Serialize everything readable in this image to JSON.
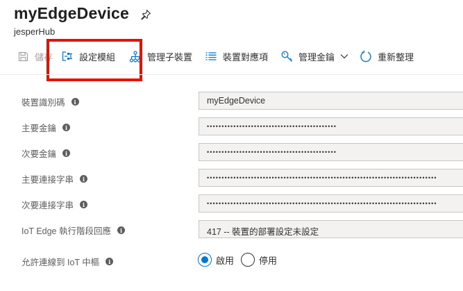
{
  "header": {
    "title": "myEdgeDevice",
    "subtitle": "jesperHub"
  },
  "toolbar": {
    "save_label": "儲存",
    "set_modules_label": "設定模組",
    "manage_children_label": "管理子裝置",
    "device_twin_label": "裝置對應項",
    "manage_keys_label": "管理金鑰",
    "refresh_label": "重新整理"
  },
  "form": {
    "device_id": {
      "label": "裝置識別碼",
      "value": "myEdgeDevice"
    },
    "primary_key": {
      "label": "主要金鑰",
      "value": "••••••••••••••••••••••••••••••••••••••••••••"
    },
    "secondary_key": {
      "label": "次要金鑰",
      "value": "••••••••••••••••••••••••••••••••••••••••••••"
    },
    "primary_conn": {
      "label": "主要連接字串",
      "value": "••••••••••••••••••••••••••••••••••••••••••••••••••••••••••••••••••••••••••••••"
    },
    "secondary_conn": {
      "label": "次要連接字串",
      "value": "••••••••••••••••••••••••••••••••••••••••••••••••••••••••••••••••••••••••••••••"
    },
    "runtime_response": {
      "label": "IoT Edge 執行階段回應",
      "value": "417 -- 裝置的部署設定未設定"
    },
    "allow_connect": {
      "label": "允許連線到 IoT 中樞",
      "enable_label": "啟用",
      "disable_label": "停用",
      "selected": "啟用"
    }
  },
  "colors": {
    "accent": "#0078d4",
    "highlight_box": "#e81000"
  },
  "icons": {
    "pin": "pin-icon",
    "save": "save-icon",
    "modules": "modules-icon",
    "children": "hierarchy-icon",
    "twin": "list-icon",
    "keys": "key-icon",
    "refresh": "refresh-icon",
    "info": "info-icon"
  }
}
